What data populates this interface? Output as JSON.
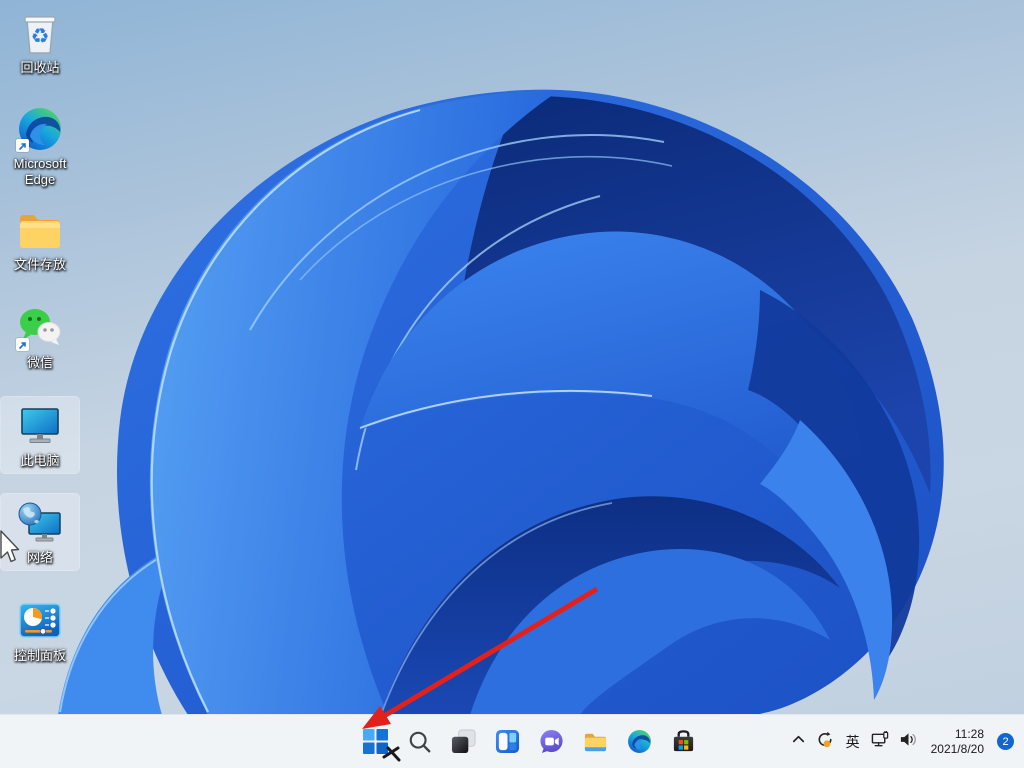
{
  "desktop": {
    "icons": [
      {
        "label": "回收站"
      },
      {
        "label": "Microsoft Edge"
      },
      {
        "label": "文件存放"
      },
      {
        "label": "微信"
      },
      {
        "label": "此电脑",
        "selected": true
      },
      {
        "label": "网络",
        "selected": true
      },
      {
        "label": "控制面板"
      }
    ]
  },
  "taskbar": {
    "buttons": [
      "start",
      "search",
      "task-view",
      "widgets",
      "chat",
      "file-explorer",
      "edge",
      "store"
    ],
    "tray": {
      "ime_label": "英",
      "time": "11:28",
      "date": "2021/8/20",
      "notification_count": "2"
    }
  },
  "annotation": {
    "arrow_color": "#e2211c",
    "arrow_target": "start-button"
  },
  "colors": {
    "taskbar_bg": "#f1f4f7",
    "badge_blue": "#1266d0",
    "wallpaper_blue": "#2f72e4"
  }
}
